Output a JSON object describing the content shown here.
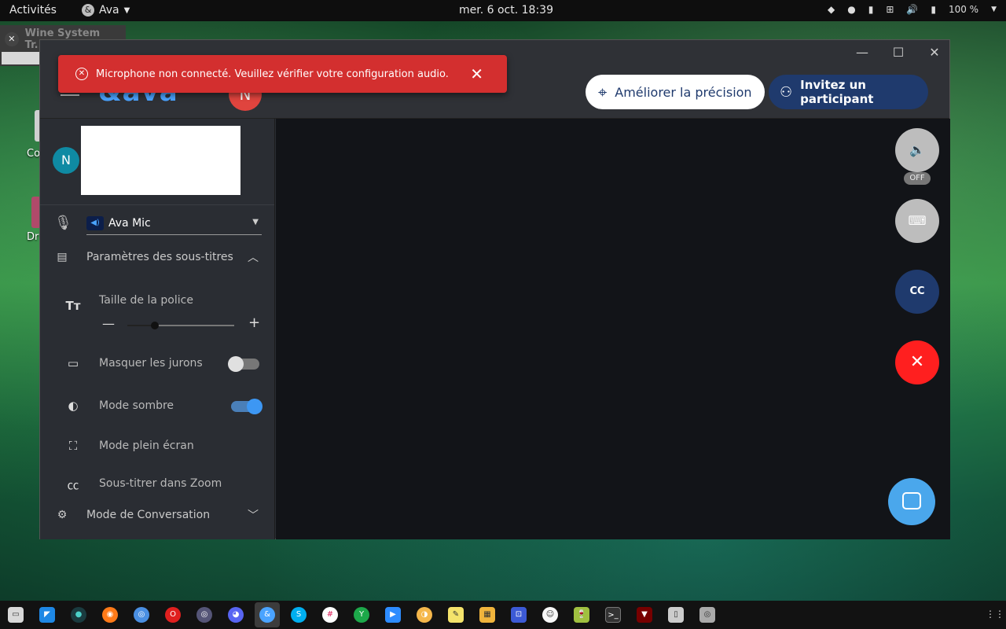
{
  "topbar": {
    "activities": "Activités",
    "app_name": "Ava",
    "clock": "mer. 6 oct.  18:39",
    "battery": "100 %"
  },
  "background_window": {
    "tab_title": "Wine System Tr..."
  },
  "desktop": {
    "label_1": "Co",
    "label_2": "Dr"
  },
  "toast": {
    "message": "Microphone non connecté. Veuillez vérifier votre configuration audio."
  },
  "header": {
    "logo": "&ava",
    "avatar_initial": "N",
    "precision_button": "Améliorer la précision",
    "invite_button": "Invitez un participant"
  },
  "sidebar": {
    "user_initial": "N",
    "mic_name": "Ava Mic",
    "subtitle_settings": "Paramètres des sous-titres",
    "font_size": "Taille de la police",
    "hide_swears": "Masquer les jurons",
    "dark_mode": "Mode sombre",
    "fullscreen": "Mode plein écran",
    "zoom_caption": "Sous-titrer dans Zoom",
    "conversation_mode": "Mode de Conversation",
    "font_size_level": 0.25,
    "hide_swears_on": false,
    "dark_mode_on": true
  },
  "main": {
    "sound_off_badge": "OFF",
    "cc_label": "CC"
  },
  "dock": {
    "items": [
      "files-icon",
      "vscode-icon",
      "app-icon",
      "firefox-icon",
      "chromium-icon",
      "opera-icon",
      "chrome-icon",
      "discord-icon",
      "ava-icon",
      "skype-icon",
      "slack-icon",
      "yandex-icon",
      "zoom-icon",
      "app2-icon",
      "notes-icon",
      "archive-icon",
      "screenshot-icon",
      "emoji-icon",
      "wine-icon",
      "terminal-icon",
      "wine2-icon",
      "usb-icon",
      "disk-icon"
    ]
  }
}
